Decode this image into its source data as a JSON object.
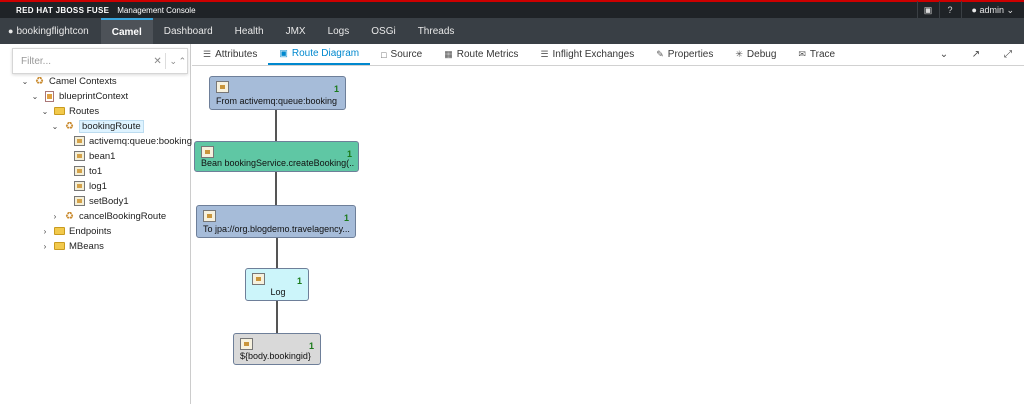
{
  "brand": {
    "name": "RED HAT JBOSS FUSE",
    "subtitle": "Management Console",
    "user": "admin"
  },
  "nav": {
    "context": "bookingflightcon",
    "items": [
      "Camel",
      "Dashboard",
      "Health",
      "JMX",
      "Logs",
      "OSGi",
      "Threads"
    ],
    "active": "Camel"
  },
  "sidebar": {
    "filter_placeholder": "Filter...",
    "tree": [
      {
        "label": "Camel Contexts"
      },
      {
        "label": "blueprintContext"
      },
      {
        "label": "Routes"
      },
      {
        "label": "bookingRoute"
      },
      {
        "label": "activemq:queue:booking"
      },
      {
        "label": "bean1"
      },
      {
        "label": "to1"
      },
      {
        "label": "log1"
      },
      {
        "label": "setBody1"
      },
      {
        "label": "cancelBookingRoute"
      },
      {
        "label": "Endpoints"
      },
      {
        "label": "MBeans"
      }
    ]
  },
  "tabs": {
    "items": [
      "Attributes",
      "Route Diagram",
      "Source",
      "Route Metrics",
      "Inflight Exchanges",
      "Properties",
      "Debug",
      "Trace"
    ],
    "active": "Route Diagram"
  },
  "diagram": {
    "nodes": [
      {
        "label": "From activemq:queue:booking",
        "count": "1"
      },
      {
        "label": "Bean bookingService.createBooking(...",
        "count": "1"
      },
      {
        "label": "To jpa://org.blogdemo.travelagency...",
        "count": "1"
      },
      {
        "label": "Log",
        "count": "1"
      },
      {
        "label": "${body.bookingid}",
        "count": "1"
      }
    ]
  },
  "colors": {
    "accent": "#0088ce",
    "nav_bg": "#393f45",
    "brand_bg": "#1f2327",
    "brand_stripe": "#cc0000"
  }
}
